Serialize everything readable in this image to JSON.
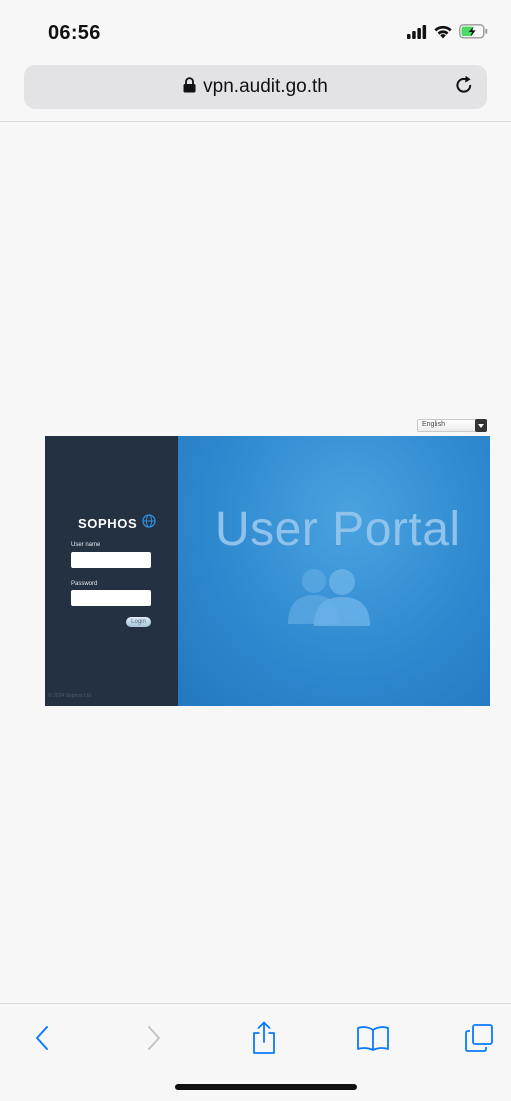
{
  "status_bar": {
    "time": "06:56",
    "icons": [
      "cellular-signal-icon",
      "wifi-icon",
      "battery-charging-icon"
    ]
  },
  "browser": {
    "url": "vpn.audit.go.th",
    "secure_icon": "lock-icon",
    "reload_icon": "reload-icon"
  },
  "page": {
    "language_selector": {
      "selected": "English"
    },
    "brand": "SOPHOS",
    "username_label": "User name",
    "username_value": "",
    "password_label": "Password",
    "password_value": "",
    "login_button": "Login",
    "copyright": "© 2024 Sophos Ltd",
    "portal_title": "User Portal"
  },
  "toolbar": {
    "buttons": [
      "back-icon",
      "forward-icon",
      "share-icon",
      "bookmarks-icon",
      "tabs-icon"
    ]
  },
  "colors": {
    "side_panel": "#243143",
    "main_panel": "#2f89cf",
    "accent": "#0a7aff"
  }
}
